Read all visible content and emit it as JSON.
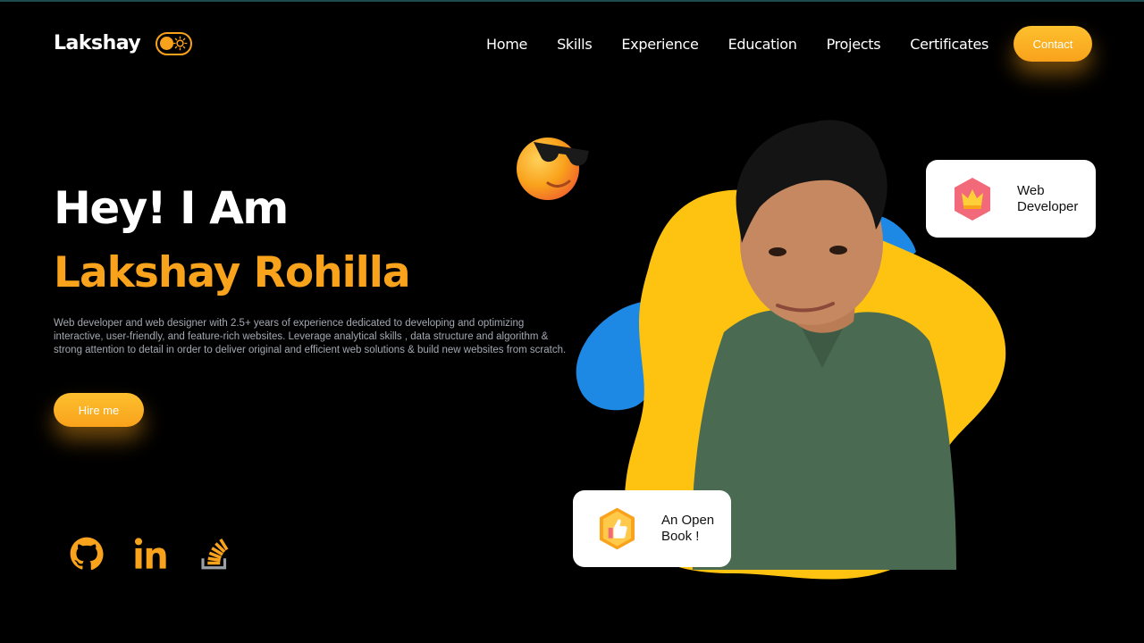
{
  "header": {
    "logo": "Lakshay",
    "theme_toggle": {
      "icon": "sun-icon",
      "state": "dark"
    },
    "nav": [
      "Home",
      "Skills",
      "Experience",
      "Education",
      "Projects",
      "Certificates"
    ],
    "contact_label": "Contact"
  },
  "hero": {
    "greeting": "Hey! I Am",
    "name": "Lakshay Rohilla",
    "description": "Web developer and web designer with 2.5+ years of experience dedicated to developing and optimizing interactive, user-friendly, and feature-rich websites. Leverage analytical skills , data structure and algorithm & strong attention to detail in order to deliver original and efficient web solutions & build new websites from scratch.",
    "hire_label": "Hire me"
  },
  "social": [
    {
      "icon": "github-icon"
    },
    {
      "icon": "linkedin-icon"
    },
    {
      "icon": "stackoverflow-icon"
    }
  ],
  "cards": {
    "web": {
      "line1": "Web",
      "line2": "Developer",
      "icon": "crown-icon"
    },
    "book": {
      "line1": "An Open",
      "line2": "Book !",
      "icon": "thumbs-up-icon"
    }
  },
  "colors": {
    "accent": "#f9a21b",
    "background": "#000000",
    "blob_yellow": "#fec310",
    "blob_blue": "#1e88e5"
  }
}
